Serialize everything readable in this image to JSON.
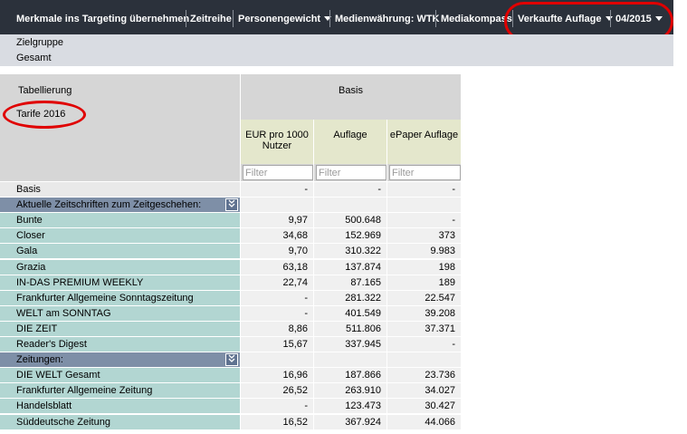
{
  "toolbar": {
    "items": [
      {
        "label": "Merkmale ins Targeting übernehmen",
        "dropdown": false
      },
      {
        "label": "Zeitreihe",
        "dropdown": false
      },
      {
        "label": "Personengewicht",
        "dropdown": true
      },
      {
        "label": "Medienwährung: WTK",
        "dropdown": false
      },
      {
        "label": "Mediakompass",
        "dropdown": false
      },
      {
        "label": "Verkaufte Auflage",
        "dropdown": true
      },
      {
        "label": "04/2015",
        "dropdown": true
      }
    ]
  },
  "filters": {
    "zielgruppe_label": "Zielgruppe",
    "gesamt_label": "Gesamt"
  },
  "table": {
    "tabellierung_label": "Tabellierung",
    "tabellierung_value": "Tarife 2016",
    "basis_header": "Basis",
    "columns": [
      {
        "label": "EUR pro 1000 Nutzer"
      },
      {
        "label": "Auflage"
      },
      {
        "label": "ePaper Auflage"
      }
    ],
    "filter_placeholder": "Filter",
    "rows": [
      {
        "type": "basis",
        "label": "Basis",
        "values": [
          "-",
          "-",
          "-"
        ]
      },
      {
        "type": "group",
        "label": "Aktuelle Zeitschriften zum Zeitgeschehen:"
      },
      {
        "type": "data",
        "label": "Bunte",
        "values": [
          "9,97",
          "500.648",
          "-"
        ]
      },
      {
        "type": "data",
        "label": "Closer",
        "values": [
          "34,68",
          "152.969",
          "373"
        ]
      },
      {
        "type": "data",
        "label": "Gala",
        "values": [
          "9,70",
          "310.322",
          "9.983"
        ]
      },
      {
        "type": "data",
        "label": "Grazia",
        "values": [
          "63,18",
          "137.874",
          "198"
        ]
      },
      {
        "type": "data",
        "label": "IN-DAS PREMIUM WEEKLY",
        "values": [
          "22,74",
          "87.165",
          "189"
        ]
      },
      {
        "type": "data",
        "label": "Frankfurter Allgemeine Sonntagszeitung",
        "values": [
          "-",
          "281.322",
          "22.547"
        ]
      },
      {
        "type": "data",
        "label": "WELT am SONNTAG",
        "values": [
          "-",
          "401.549",
          "39.208"
        ]
      },
      {
        "type": "data",
        "label": "DIE ZEIT",
        "values": [
          "8,86",
          "511.806",
          "37.371"
        ]
      },
      {
        "type": "data",
        "label": "Reader's Digest",
        "values": [
          "15,67",
          "337.945",
          "-"
        ]
      },
      {
        "type": "group",
        "label": "Zeitungen:"
      },
      {
        "type": "data",
        "label": "DIE WELT Gesamt",
        "values": [
          "16,96",
          "187.866",
          "23.736"
        ]
      },
      {
        "type": "data",
        "label": "Frankfurter Allgemeine Zeitung",
        "values": [
          "26,52",
          "263.910",
          "34.027"
        ]
      },
      {
        "type": "data",
        "label": "Handelsblatt",
        "values": [
          "-",
          "123.473",
          "30.427"
        ]
      },
      {
        "type": "data",
        "label": "Süddeutsche Zeitung",
        "values": [
          "16,52",
          "367.924",
          "44.066"
        ]
      }
    ]
  },
  "colors": {
    "toolbar_bg": "#2b313b",
    "annotation": "#e00000",
    "row_label_teal": "#b2d6d2",
    "group_header": "#7e8fa7",
    "column_header": "#e4e7cc"
  }
}
